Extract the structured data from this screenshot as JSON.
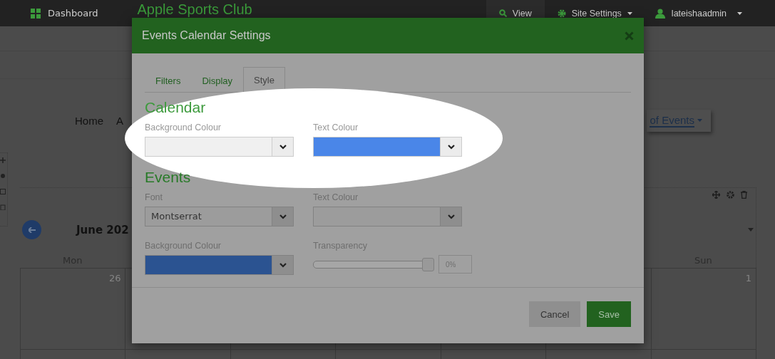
{
  "top_bar": {
    "dashboard": "Dashboard",
    "site_name": "Apple Sports Club",
    "links": [
      {
        "label": "View",
        "kind": "search"
      },
      {
        "label": "Site Settings",
        "kind": "settings"
      }
    ],
    "user": "lateishaadmin"
  },
  "page": {
    "nav": [
      "Home",
      "A"
    ],
    "events_menu": "of Events",
    "calendar": {
      "month": "June 202",
      "first_column": {
        "weekday": "Mon",
        "day": "26"
      },
      "last_column": {
        "weekday": "Sun",
        "day": "1"
      }
    }
  },
  "modal": {
    "title": "Events Calendar Settings",
    "tabs": [
      {
        "label": "Filters",
        "selected": false
      },
      {
        "label": "Display",
        "selected": false
      },
      {
        "label": "Style",
        "selected": true
      }
    ],
    "sections": [
      {
        "heading": "Calendar",
        "highlighted": true,
        "fields": [
          {
            "label": "Background Colour",
            "kind": "colour",
            "color": "#f0f0f0"
          },
          {
            "label": "Text Colour",
            "kind": "colour",
            "color": "#4a86e8"
          }
        ]
      },
      {
        "heading": "Events",
        "highlighted": false,
        "fields": [
          {
            "label": "Font",
            "kind": "select",
            "value": "Montserrat"
          },
          {
            "label": "Text Colour",
            "kind": "colour"
          },
          {
            "label": "Background Colour",
            "kind": "colour",
            "color": "#2b5391"
          },
          {
            "label": "Transparency",
            "kind": "slider",
            "level": 1,
            "reading": "0%"
          }
        ]
      }
    ],
    "buttons": [
      {
        "label": "Cancel",
        "kind": "secondary"
      },
      {
        "label": "Save",
        "kind": "primary"
      }
    ]
  }
}
